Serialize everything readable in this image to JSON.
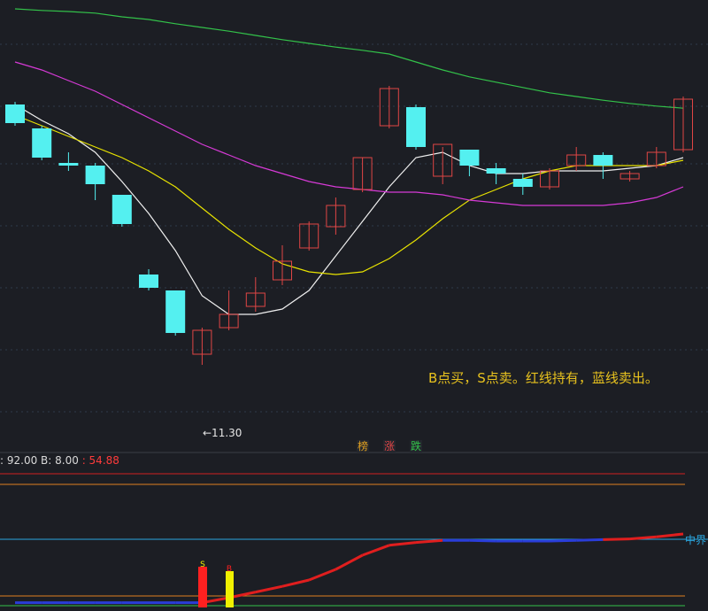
{
  "colors": {
    "background": "#1c1e24",
    "up": "#e04545",
    "down": "#54f0f0",
    "ma_white": "#f0f0f0",
    "ma_yellow": "#e8e300",
    "ma_magenta": "#d63ad6",
    "ma_green": "#33c24a",
    "indicator_red": "#e01e1e",
    "indicator_blue": "#2a3dd8",
    "zhongjie_line": "#2aa7e0"
  },
  "annotation": "B点买，S点卖。红线持有，蓝线卖出。",
  "min_label": "←11.30",
  "badges": [
    {
      "label": "榜",
      "color": "#e0a020"
    },
    {
      "label": "涨",
      "color": "#e04545"
    },
    {
      "label": "跌",
      "color": "#33c24a"
    }
  ],
  "indicator": {
    "param_a": ": 92.00",
    "param_b": "B: 8.00",
    "param_c": ": 54.88",
    "zhongjie_label": "中界",
    "signal_s": "S",
    "signal_b": "B"
  },
  "chart_data": {
    "type": "candlestick",
    "price_range": [
      10.5,
      18.0
    ],
    "candles": [
      {
        "o": 16.2,
        "h": 16.25,
        "l": 15.8,
        "c": 15.85
      },
      {
        "o": 15.75,
        "h": 15.8,
        "l": 15.15,
        "c": 15.2
      },
      {
        "o": 15.1,
        "h": 15.3,
        "l": 14.95,
        "c": 15.05
      },
      {
        "o": 15.05,
        "h": 15.1,
        "l": 14.4,
        "c": 14.7
      },
      {
        "o": 14.5,
        "h": 14.5,
        "l": 13.9,
        "c": 13.95
      },
      {
        "o": 13.0,
        "h": 13.1,
        "l": 12.7,
        "c": 12.75
      },
      {
        "o": 12.7,
        "h": 12.7,
        "l": 11.85,
        "c": 11.9
      },
      {
        "o": 11.5,
        "h": 12.0,
        "l": 11.3,
        "c": 11.95
      },
      {
        "o": 12.0,
        "h": 12.7,
        "l": 11.95,
        "c": 12.25
      },
      {
        "o": 12.4,
        "h": 12.95,
        "l": 12.3,
        "c": 12.65
      },
      {
        "o": 12.9,
        "h": 13.55,
        "l": 12.8,
        "c": 13.25
      },
      {
        "o": 13.5,
        "h": 14.0,
        "l": 13.45,
        "c": 13.95
      },
      {
        "o": 13.9,
        "h": 14.45,
        "l": 13.75,
        "c": 14.3
      },
      {
        "o": 14.6,
        "h": 15.2,
        "l": 14.55,
        "c": 15.2
      },
      {
        "o": 15.8,
        "h": 16.55,
        "l": 15.75,
        "c": 16.5
      },
      {
        "o": 16.15,
        "h": 16.2,
        "l": 15.35,
        "c": 15.4
      },
      {
        "o": 14.85,
        "h": 15.4,
        "l": 14.7,
        "c": 15.45
      },
      {
        "o": 15.35,
        "h": 15.35,
        "l": 14.85,
        "c": 15.05
      },
      {
        "o": 15.0,
        "h": 15.1,
        "l": 14.7,
        "c": 14.9
      },
      {
        "o": 14.8,
        "h": 14.9,
        "l": 14.5,
        "c": 14.65
      },
      {
        "o": 14.65,
        "h": 15.0,
        "l": 14.6,
        "c": 14.95
      },
      {
        "o": 15.05,
        "h": 15.4,
        "l": 14.95,
        "c": 15.25
      },
      {
        "o": 15.25,
        "h": 15.3,
        "l": 14.8,
        "c": 15.05
      },
      {
        "o": 14.8,
        "h": 14.95,
        "l": 14.75,
        "c": 14.9
      },
      {
        "o": 15.05,
        "h": 15.4,
        "l": 15.0,
        "c": 15.3
      },
      {
        "o": 15.35,
        "h": 16.35,
        "l": 15.3,
        "c": 16.3
      }
    ],
    "ma": [
      {
        "color_key": "ma_white",
        "values": [
          16.2,
          15.9,
          15.65,
          15.3,
          14.75,
          14.15,
          13.45,
          12.6,
          12.25,
          12.25,
          12.35,
          12.7,
          13.35,
          14.0,
          14.65,
          15.2,
          15.3,
          15.05,
          14.9,
          14.9,
          14.95,
          14.95,
          14.95,
          15.0,
          15.05,
          15.2
        ]
      },
      {
        "color_key": "ma_yellow",
        "values": [
          16.0,
          15.8,
          15.6,
          15.4,
          15.2,
          14.95,
          14.65,
          14.25,
          13.85,
          13.5,
          13.2,
          13.05,
          13.0,
          13.05,
          13.3,
          13.65,
          14.05,
          14.4,
          14.6,
          14.8,
          14.95,
          15.05,
          15.05,
          15.05,
          15.05,
          15.15
        ]
      },
      {
        "color_key": "ma_magenta",
        "values": [
          17.0,
          16.85,
          16.65,
          16.45,
          16.2,
          15.95,
          15.7,
          15.45,
          15.25,
          15.05,
          14.9,
          14.75,
          14.65,
          14.6,
          14.55,
          14.55,
          14.5,
          14.4,
          14.35,
          14.3,
          14.3,
          14.3,
          14.3,
          14.35,
          14.45,
          14.65
        ]
      },
      {
        "color_key": "ma_green",
        "values": [
          18.0,
          17.97,
          17.95,
          17.92,
          17.85,
          17.8,
          17.72,
          17.65,
          17.58,
          17.5,
          17.42,
          17.35,
          17.28,
          17.22,
          17.15,
          17.0,
          16.85,
          16.72,
          16.62,
          16.52,
          16.42,
          16.35,
          16.28,
          16.22,
          16.17,
          16.13
        ]
      }
    ],
    "indicator_line": [
      3.0,
      3.0,
      3.0,
      3.0,
      3.0,
      3.0,
      3.0,
      3.0,
      10,
      18,
      26,
      35,
      50,
      70,
      84,
      88,
      91,
      91,
      90,
      90,
      90,
      91,
      92,
      93,
      96,
      100
    ]
  }
}
